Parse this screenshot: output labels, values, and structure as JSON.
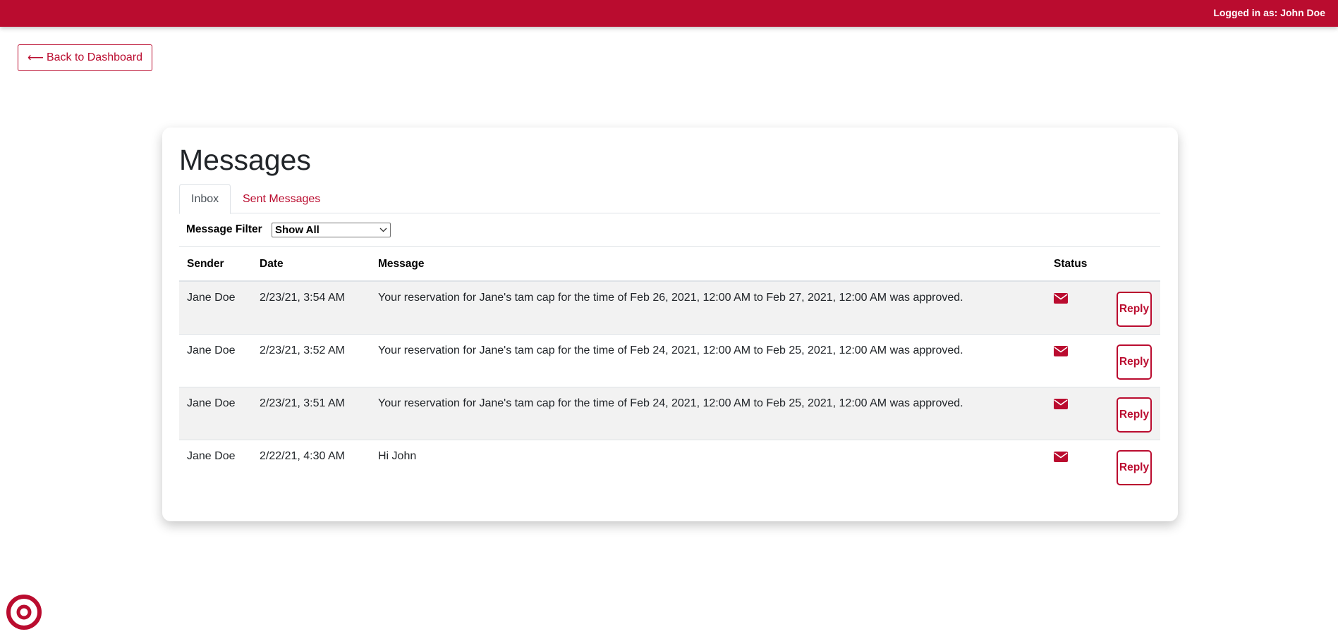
{
  "header": {
    "login_text": "Logged in as: John Doe"
  },
  "nav": {
    "back_arrow": "⟵",
    "back_label": "Back to Dashboard"
  },
  "page": {
    "title": "Messages"
  },
  "tabs": [
    {
      "label": "Inbox",
      "active": true
    },
    {
      "label": "Sent Messages",
      "active": false
    }
  ],
  "filter": {
    "label": "Message Filter",
    "selected": "Show All"
  },
  "table": {
    "headers": {
      "sender": "Sender",
      "date": "Date",
      "message": "Message",
      "status": "Status"
    },
    "rows": [
      {
        "sender": "Jane Doe",
        "date": "2/23/21, 3:54 AM",
        "message": "Your reservation for Jane's tam cap for the time of Feb 26, 2021, 12:00 AM to Feb 27, 2021, 12:00 AM was approved.",
        "status_icon": "envelope-icon",
        "reply_label": "Reply"
      },
      {
        "sender": "Jane Doe",
        "date": "2/23/21, 3:52 AM",
        "message": "Your reservation for Jane's tam cap for the time of Feb 24, 2021, 12:00 AM to Feb 25, 2021, 12:00 AM was approved.",
        "status_icon": "envelope-icon",
        "reply_label": "Reply"
      },
      {
        "sender": "Jane Doe",
        "date": "2/23/21, 3:51 AM",
        "message": "Your reservation for Jane's tam cap for the time of Feb 24, 2021, 12:00 AM to Feb 25, 2021, 12:00 AM was approved.",
        "status_icon": "envelope-icon",
        "reply_label": "Reply"
      },
      {
        "sender": "Jane Doe",
        "date": "2/22/21, 4:30 AM",
        "message": "Hi John",
        "status_icon": "envelope-icon",
        "reply_label": "Reply"
      }
    ]
  },
  "colors": {
    "brand": "#ba0c2f",
    "row_stripe": "#f2f2f2",
    "border": "#dee2e6"
  },
  "icons": {
    "status": "envelope-icon",
    "corner": "target-logo-icon"
  }
}
